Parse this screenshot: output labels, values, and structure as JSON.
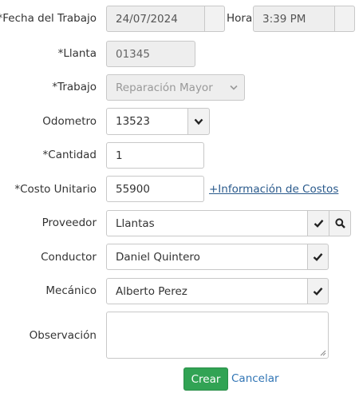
{
  "fields": {
    "fecha": {
      "label": "*Fecha del Trabajo",
      "value": "24/07/2024"
    },
    "hora": {
      "label": "Hora",
      "value": "3:39 PM"
    },
    "llanta": {
      "label": "*Llanta",
      "value": "01345"
    },
    "trabajo": {
      "label": "*Trabajo",
      "value": "Reparación Mayor"
    },
    "odometro": {
      "label": "Odometro",
      "value": "13523"
    },
    "cantidad": {
      "label": "*Cantidad",
      "value": "1"
    },
    "costo": {
      "label": "*Costo Unitario",
      "value": "55900",
      "link": "+Información de Costos"
    },
    "proveedor": {
      "label": "Proveedor",
      "value": "Llantas"
    },
    "conductor": {
      "label": "Conductor",
      "value": "Daniel Quintero"
    },
    "mecanico": {
      "label": "Mecánico",
      "value": "Alberto Perez"
    },
    "observacion": {
      "label": "Observación",
      "value": ""
    }
  },
  "actions": {
    "create_label": "Crear",
    "cancel_label": "Cancelar"
  },
  "icons": {
    "check": "check-icon",
    "search": "search-icon",
    "chevron": "chevron-down-icon",
    "resize": "resize-grip-icon"
  },
  "colors": {
    "primary": "#31a354",
    "link": "#3175b5",
    "disabled_bg": "#eeeeee"
  }
}
